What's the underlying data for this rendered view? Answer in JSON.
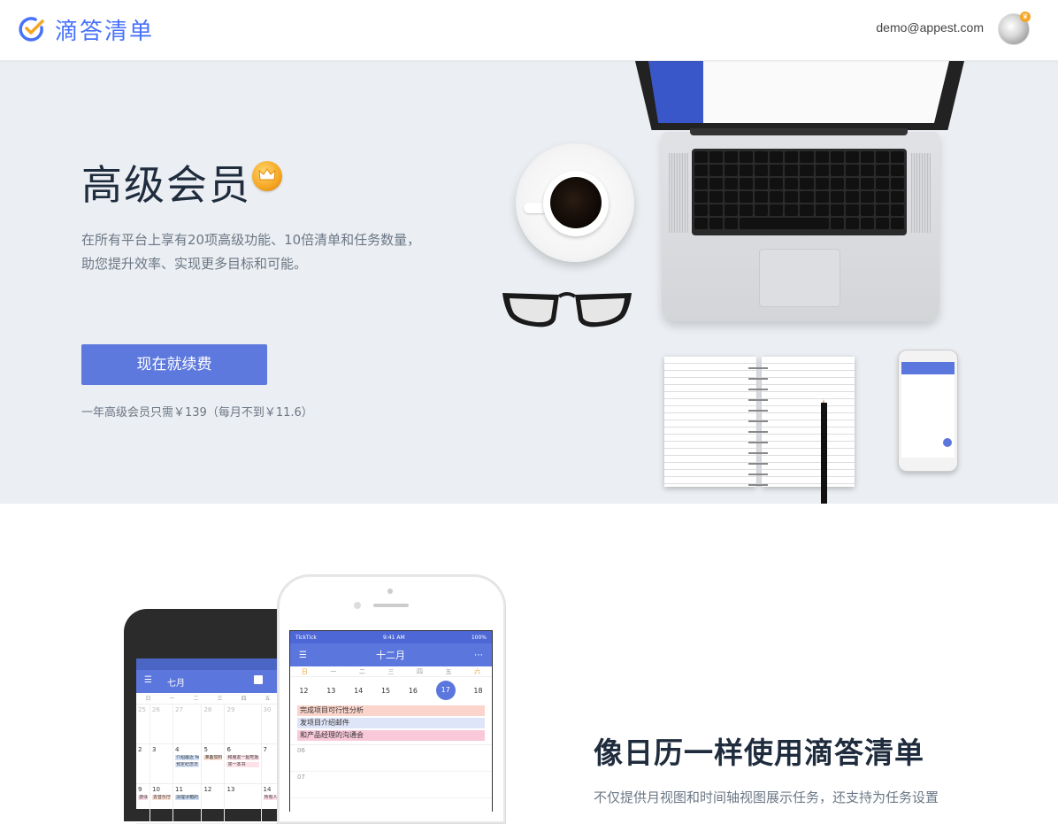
{
  "header": {
    "brand": "滴答清单",
    "user_email": "demo@appest.com"
  },
  "hero": {
    "title": "高级会员",
    "description": "在所有平台上享有20项高级功能、10倍清单和任务数量，助您提升效率、实现更多目标和可能。",
    "renew_button": "现在就续费",
    "price_note": "一年高级会员只需￥139（每月不到￥11.6）"
  },
  "android_demo": {
    "month": "七月",
    "weekdays": [
      "日",
      "一",
      "二",
      "三",
      "四",
      "五"
    ],
    "rows": [
      [
        {
          "d": "25",
          "dim": true
        },
        {
          "d": "26",
          "dim": true
        },
        {
          "d": "27",
          "dim": true
        },
        {
          "d": "28",
          "dim": true
        },
        {
          "d": "29",
          "dim": true
        },
        {
          "d": "30",
          "dim": true
        }
      ],
      [
        {
          "d": "2"
        },
        {
          "d": "3"
        },
        {
          "d": "4",
          "events": [
            {
              "t": "介绍最近 fe",
              "c": "#cfe0f7"
            },
            {
              "t": "预定纪念日",
              "c": "#dbe7fb"
            }
          ]
        },
        {
          "d": "5",
          "events": [
            {
              "t": "准备加料",
              "c": "#fde1d5"
            }
          ]
        },
        {
          "d": "6",
          "events": [
            {
              "t": "和朋友一起吃饭",
              "c": "#fde1e8"
            },
            {
              "t": "买一本书",
              "c": "#fde1e8"
            }
          ]
        },
        {
          "d": "7"
        }
      ],
      [
        {
          "d": "9",
          "events": [
            {
              "t": "游泳",
              "c": "#fde1e8"
            }
          ]
        },
        {
          "d": "10",
          "events": [
            {
              "t": "去音乐厅",
              "c": "#fde1d5"
            }
          ]
        },
        {
          "d": "11",
          "events": [
            {
              "t": "清理冰箱的",
              "c": "#cfe0f7"
            }
          ]
        },
        {
          "d": "12"
        },
        {
          "d": "13"
        },
        {
          "d": "14",
          "events": [
            {
              "t": "所有人的",
              "c": "#fde1e8"
            }
          ]
        }
      ]
    ]
  },
  "ios_demo": {
    "carrier": "TickTick",
    "time": "9:41 AM",
    "battery": "100%",
    "month": "十二月",
    "weekdays": [
      "日",
      "一",
      "二",
      "三",
      "四",
      "五",
      "六"
    ],
    "dates": [
      "12",
      "13",
      "14",
      "15",
      "16",
      "17",
      "18"
    ],
    "today": "17",
    "events": [
      {
        "title": "完成项目可行性分析",
        "color": "#fbd5cc"
      },
      {
        "title": "发项目介绍邮件",
        "color": "#dfe5f8"
      },
      {
        "title": "和产品经理的沟通会",
        "color": "#f9c9da"
      }
    ],
    "hours": [
      "06",
      "07"
    ]
  },
  "feature": {
    "title": "像日历一样使用滴答清单",
    "description": "不仅提供月视图和时间轴视图展示任务，还支持为任务设置"
  },
  "colors": {
    "brand": "#4772fa",
    "button": "#5e79de",
    "hero_bg": "#ebeef2",
    "title": "#1f2c3d",
    "muted": "#6b7785"
  }
}
